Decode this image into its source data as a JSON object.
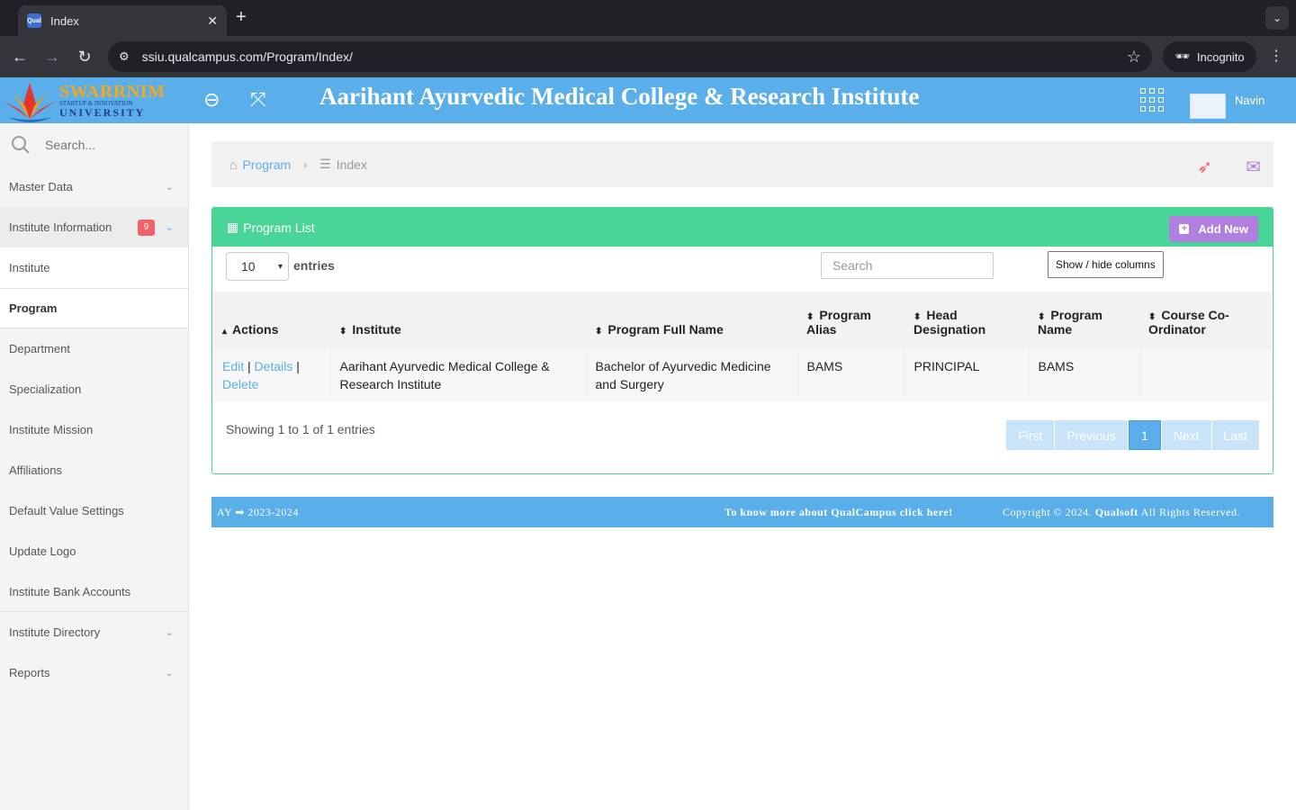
{
  "browser": {
    "tab_title": "Index",
    "tab_favicon_text": "Qual",
    "url": "ssiu.qualcampus.com/Program/Index/",
    "incognito_label": "Incognito"
  },
  "header": {
    "logo": {
      "line1": "SWARRNIM",
      "line2": "STARTUP & INNOVATION",
      "line3": "UNIVERSITY"
    },
    "institute_title": "Aarihant Ayurvedic Medical College & Research Institute",
    "user_name": "Navin"
  },
  "sidebar": {
    "search_placeholder": "Search...",
    "items": [
      {
        "label": "Master Data"
      },
      {
        "label": "Institute Information",
        "badge": "9"
      },
      {
        "label": "Institute"
      },
      {
        "label": "Program"
      },
      {
        "label": "Department"
      },
      {
        "label": "Specialization"
      },
      {
        "label": "Institute Mission"
      },
      {
        "label": "Affiliations"
      },
      {
        "label": "Default Value Settings"
      },
      {
        "label": "Update Logo"
      },
      {
        "label": "Institute Bank Accounts"
      },
      {
        "label": "Institute Directory"
      },
      {
        "label": "Reports"
      }
    ]
  },
  "breadcrumb": {
    "link": "Program",
    "current": "Index"
  },
  "panel": {
    "title": "Program List",
    "add_new": "Add New",
    "page_size": "10",
    "entries_label": "entries",
    "search_placeholder": "Search",
    "show_hide": "Show / hide columns",
    "columns": [
      "Actions",
      "Institute",
      "Program Full Name",
      "Program Alias",
      "Head Designation",
      "Program Name",
      "Course Co-Ordinator"
    ],
    "rows": [
      {
        "edit": "Edit",
        "details": "Details",
        "delete": "Delete",
        "institute": "Aarihant Ayurvedic Medical College & Research Institute",
        "full_name": "Bachelor of Ayurvedic Medicine and Surgery",
        "alias": "BAMS",
        "head": "PRINCIPAL",
        "name": "BAMS",
        "coordinator": ""
      }
    ],
    "showing": "Showing 1 to 1 of 1 entries",
    "pager": [
      "First",
      "Previous",
      "1",
      "Next",
      "Last"
    ]
  },
  "footer": {
    "ay_label": "AY",
    "ay_value": "2023-2024",
    "know_more": "To know more about QualCampus click here!",
    "copyright_prefix": "Copyright © 2024.",
    "company": "Qualsoft",
    "copyright_suffix": "All Rights Reserved."
  },
  "colors": {
    "header": "#5aaee9",
    "panel": "#48d597",
    "add_new": "#b17fe0",
    "badge": "#f1616a"
  }
}
